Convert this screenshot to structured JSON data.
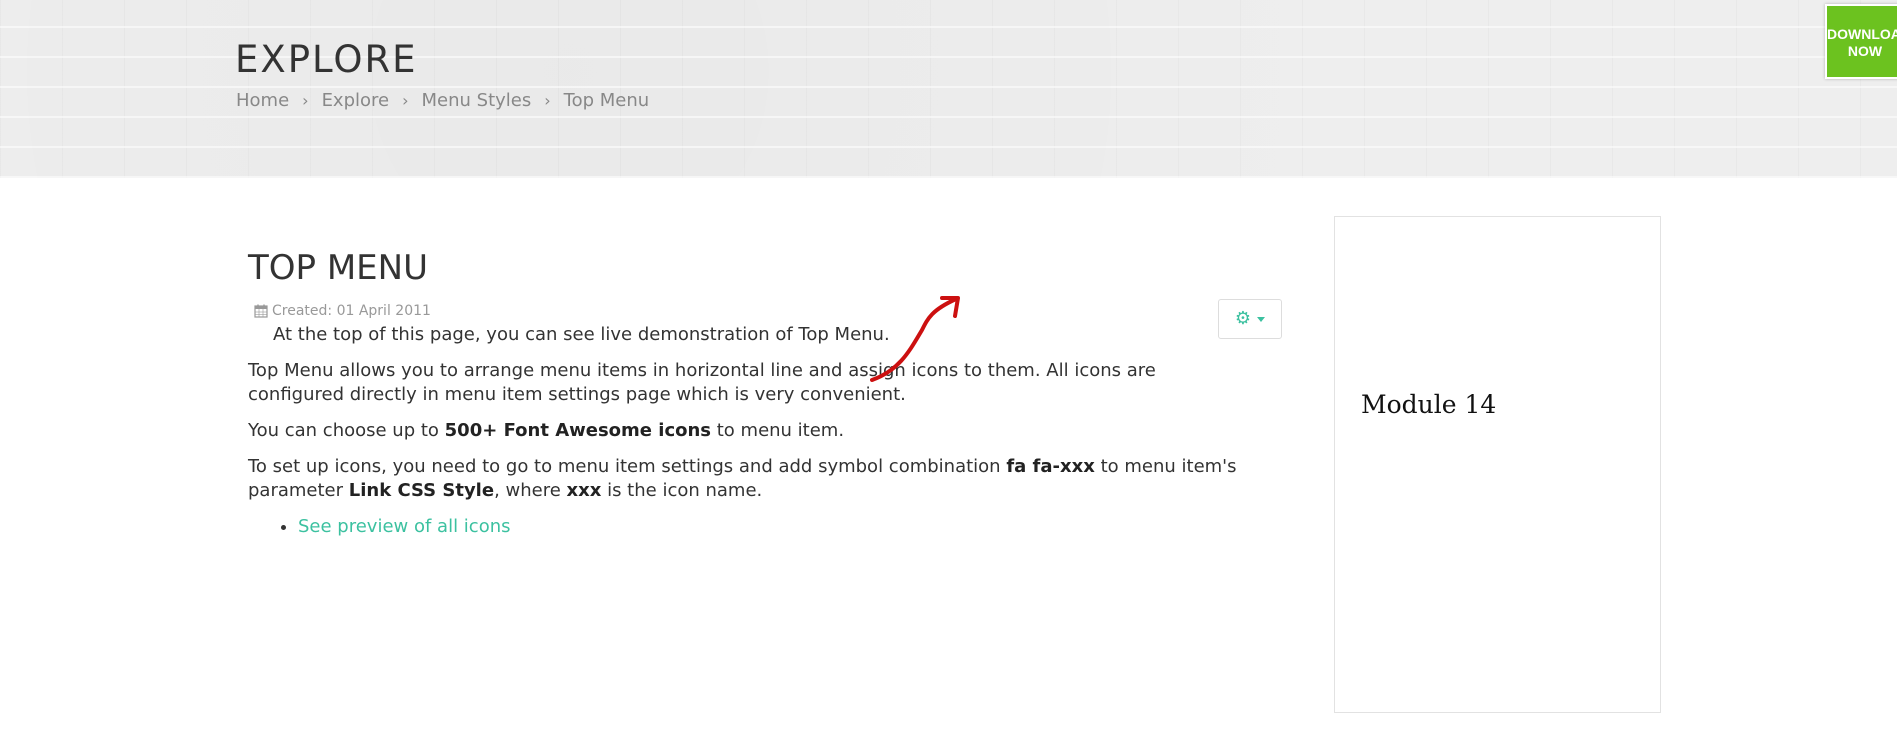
{
  "hero": {
    "title": "EXPLORE",
    "breadcrumb": [
      "Home",
      "Explore",
      "Menu Styles",
      "Top Menu"
    ]
  },
  "download": {
    "line1": "DOWNLOAD",
    "line2": "NOW",
    "color": "#6cc21f"
  },
  "article": {
    "title": "TOP MENU",
    "created": "Created: 01 April 2011",
    "intro": "At the top of this page, you can see live demonstration of Top Menu.",
    "para1": "Top Menu allows you to arrange menu items in horizontal line and assign icons to them. All icons are configured directly in menu item settings page which is very convenient.",
    "para2_pre": "You can choose up to ",
    "para2_bold": "500+ Font Awesome icons",
    "para2_post": " to menu item.",
    "para3_a": "To set up icons, you need to go to menu item settings and add symbol combination ",
    "para3_bold1": "fa fa-xxx",
    "para3_b": " to menu item's parameter ",
    "para3_bold2": "Link CSS Style",
    "para3_c": ", where ",
    "para3_bold3": "xxx",
    "para3_d": " is the icon name.",
    "link": "See preview of all icons",
    "link_color": "#3cc1a0",
    "tools_icon": "gear-icon"
  },
  "sidebar": {
    "module_label": "Module 14"
  },
  "annotation": {
    "arrow_color": "#cc1010"
  }
}
